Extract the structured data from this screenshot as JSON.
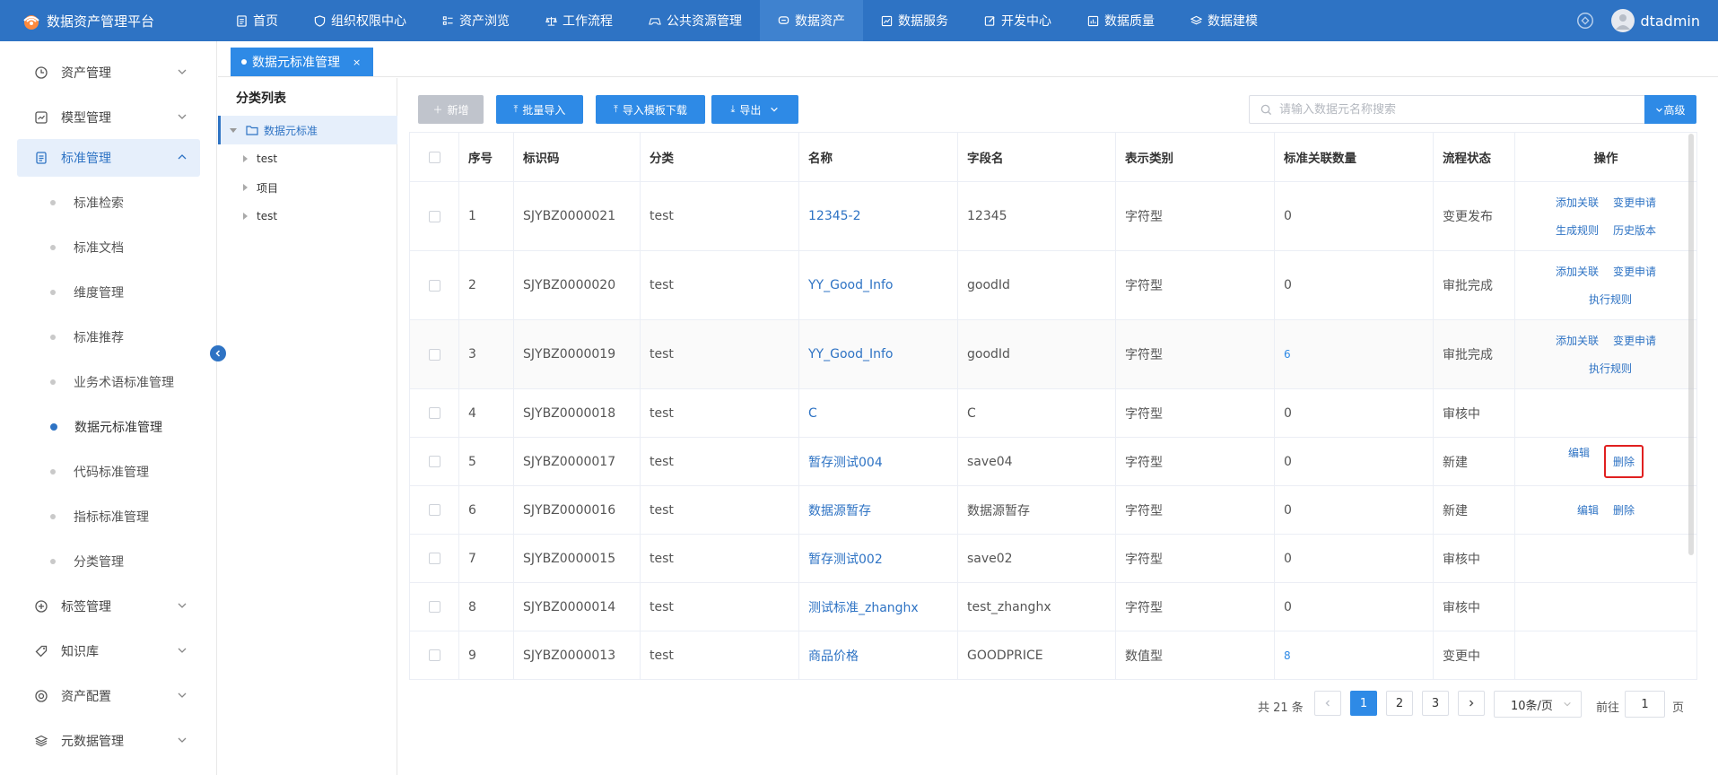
{
  "app": {
    "title": "数据资产管理平台",
    "user": "dtadmin"
  },
  "nav": [
    {
      "label": "首页",
      "icon": "document-icon"
    },
    {
      "label": "组织权限中心",
      "icon": "shield-icon"
    },
    {
      "label": "资产浏览",
      "icon": "list-icon"
    },
    {
      "label": "工作流程",
      "icon": "balance-icon"
    },
    {
      "label": "公共资源管理",
      "icon": "gamepad-icon"
    },
    {
      "label": "数据资产",
      "icon": "chat-icon"
    },
    {
      "label": "数据服务",
      "icon": "chart-icon"
    },
    {
      "label": "开发中心",
      "icon": "edit-icon"
    },
    {
      "label": "数据质量",
      "icon": "report-icon"
    },
    {
      "label": "数据建模",
      "icon": "layers-icon"
    }
  ],
  "sidebar": {
    "groups": [
      {
        "label": "资产管理",
        "icon": "clock-icon"
      },
      {
        "label": "模型管理",
        "icon": "chart-box-icon"
      },
      {
        "label": "标准管理",
        "icon": "document-icon"
      },
      {
        "label": "标签管理",
        "icon": "plus-circle-icon"
      },
      {
        "label": "知识库",
        "icon": "tag-icon"
      },
      {
        "label": "资产配置",
        "icon": "settings-icon"
      },
      {
        "label": "元数据管理",
        "icon": "layers-icon"
      }
    ],
    "sub_items": [
      "标准检索",
      "标准文档",
      "维度管理",
      "标准推荐",
      "业务术语标准管理",
      "数据元标准管理",
      "代码标准管理",
      "指标标准管理",
      "分类管理"
    ]
  },
  "tab": {
    "label": "数据元标准管理",
    "close": "×"
  },
  "tree": {
    "title": "分类列表",
    "root": "数据元标准",
    "children": [
      "test",
      "项目",
      "test"
    ]
  },
  "toolbar": {
    "add": "新增",
    "batch_import": "批量导入",
    "template_download": "导入模板下载",
    "export": "导出",
    "search_placeholder": "请输入数据元名称搜索",
    "advanced": "高级"
  },
  "table": {
    "headers": [
      "序号",
      "标识码",
      "分类",
      "名称",
      "字段名",
      "表示类别",
      "标准关联数量",
      "流程状态",
      "操作"
    ],
    "rows": [
      {
        "no": "1",
        "code": "SJYBZ0000021",
        "category": "test",
        "name": "12345-2",
        "field": "12345",
        "type": "字符型",
        "count": "0",
        "status": "变更发布",
        "ops": [
          [
            "添加关联",
            "变更申请"
          ],
          [
            "生成规则",
            "历史版本"
          ]
        ]
      },
      {
        "no": "2",
        "code": "SJYBZ0000020",
        "category": "test",
        "name": "YY_Good_Info",
        "field": "goodId",
        "type": "字符型",
        "count": "0",
        "status": "审批完成",
        "ops": [
          [
            "添加关联",
            "变更申请"
          ],
          [
            "执行规则"
          ]
        ]
      },
      {
        "no": "3",
        "code": "SJYBZ0000019",
        "category": "test",
        "name": "YY_Good_Info",
        "field": "goodId",
        "type": "字符型",
        "count": "6",
        "status": "审批完成",
        "ops": [
          [
            "添加关联",
            "变更申请"
          ],
          [
            "执行规则"
          ]
        ]
      },
      {
        "no": "4",
        "code": "SJYBZ0000018",
        "category": "test",
        "name": "C",
        "field": "C",
        "type": "字符型",
        "count": "0",
        "status": "审核中",
        "ops": []
      },
      {
        "no": "5",
        "code": "SJYBZ0000017",
        "category": "test",
        "name": "暂存测试004",
        "field": "save04",
        "type": "字符型",
        "count": "0",
        "status": "新建",
        "ops": [
          [
            "编辑",
            "删除"
          ]
        ]
      },
      {
        "no": "6",
        "code": "SJYBZ0000016",
        "category": "test",
        "name": "数据源暂存",
        "field": "数据源暂存",
        "type": "字符型",
        "count": "0",
        "status": "新建",
        "ops": [
          [
            "编辑",
            "删除"
          ]
        ]
      },
      {
        "no": "7",
        "code": "SJYBZ0000015",
        "category": "test",
        "name": "暂存测试002",
        "field": "save02",
        "type": "字符型",
        "count": "0",
        "status": "审核中",
        "ops": []
      },
      {
        "no": "8",
        "code": "SJYBZ0000014",
        "category": "test",
        "name": "测试标准_zhanghx",
        "field": "test_zhanghx",
        "type": "字符型",
        "count": "0",
        "status": "审核中",
        "ops": []
      },
      {
        "no": "9",
        "code": "SJYBZ0000013",
        "category": "test",
        "name": "商品价格",
        "field": "GOODPRICE",
        "type": "数值型",
        "count": "8",
        "status": "变更中",
        "ops": []
      }
    ]
  },
  "pagination": {
    "total": "共 21 条",
    "pages": [
      "1",
      "2",
      "3"
    ],
    "current": "1",
    "page_size": "10条/页",
    "goto_label": "前往",
    "goto_value": "1",
    "goto_unit": "页"
  },
  "colors": {
    "primary": "#2e73c4",
    "button": "#2e8ae6",
    "highlight": "#e02020"
  }
}
